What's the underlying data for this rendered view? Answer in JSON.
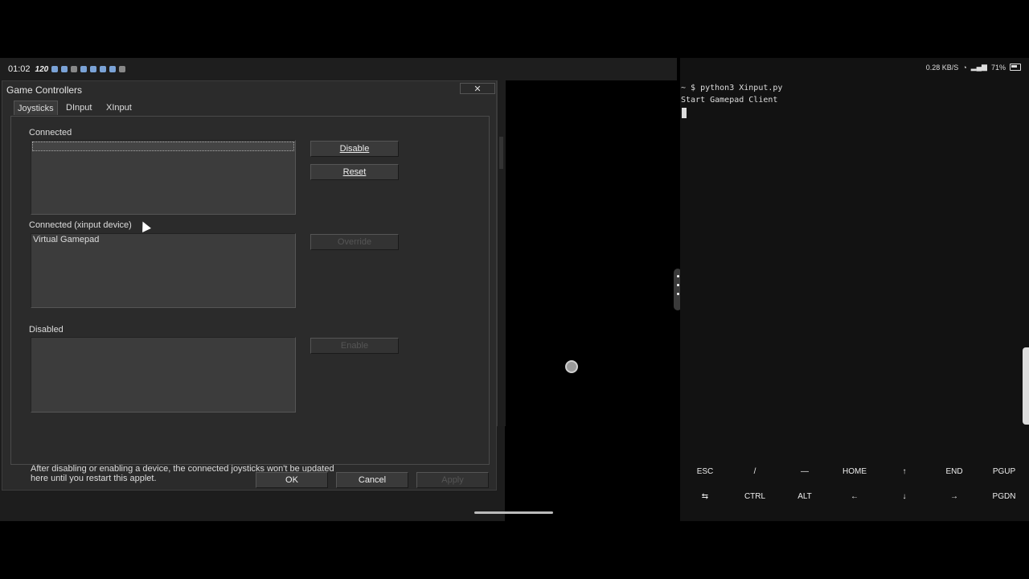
{
  "left_status": {
    "time": "01:02",
    "refresh_rate": "120",
    "icons": [
      "app-icon",
      "app-icon",
      "x-icon",
      "app-icon",
      "app-icon",
      "app-icon",
      "app-icon",
      "terminal-icon"
    ]
  },
  "dialog": {
    "title": "Game Controllers",
    "close_glyph": "✕",
    "tabs": [
      {
        "label": "Joysticks",
        "active": true
      },
      {
        "label": "DInput",
        "active": false
      },
      {
        "label": "XInput",
        "active": false
      }
    ],
    "connected_label": "Connected",
    "connected_items": [],
    "disable_button": "Disable",
    "reset_button": "Reset",
    "xinput_label": "Connected (xinput device)",
    "xinput_items": [
      "Virtual Gamepad"
    ],
    "override_button": "Override",
    "disabled_label": "Disabled",
    "disabled_items": [],
    "enable_button": "Enable",
    "note": "After disabling or enabling a device, the connected joysticks won't be updated here until you restart this applet.",
    "ok_button": "OK",
    "cancel_button": "Cancel",
    "apply_button": "Apply"
  },
  "right_status": {
    "net_speed": "0.28",
    "net_unit": "KB/S",
    "battery": "71%"
  },
  "terminal": {
    "lines": [
      "~ $ python3 Xinput.py",
      "Start Gamepad Client"
    ],
    "extra_keys": [
      [
        "ESC",
        "/",
        "—",
        "HOME",
        "↑",
        "END",
        "PGUP"
      ],
      [
        "⇆",
        "CTRL",
        "ALT",
        "←",
        "↓",
        "→",
        "PGDN"
      ]
    ]
  }
}
